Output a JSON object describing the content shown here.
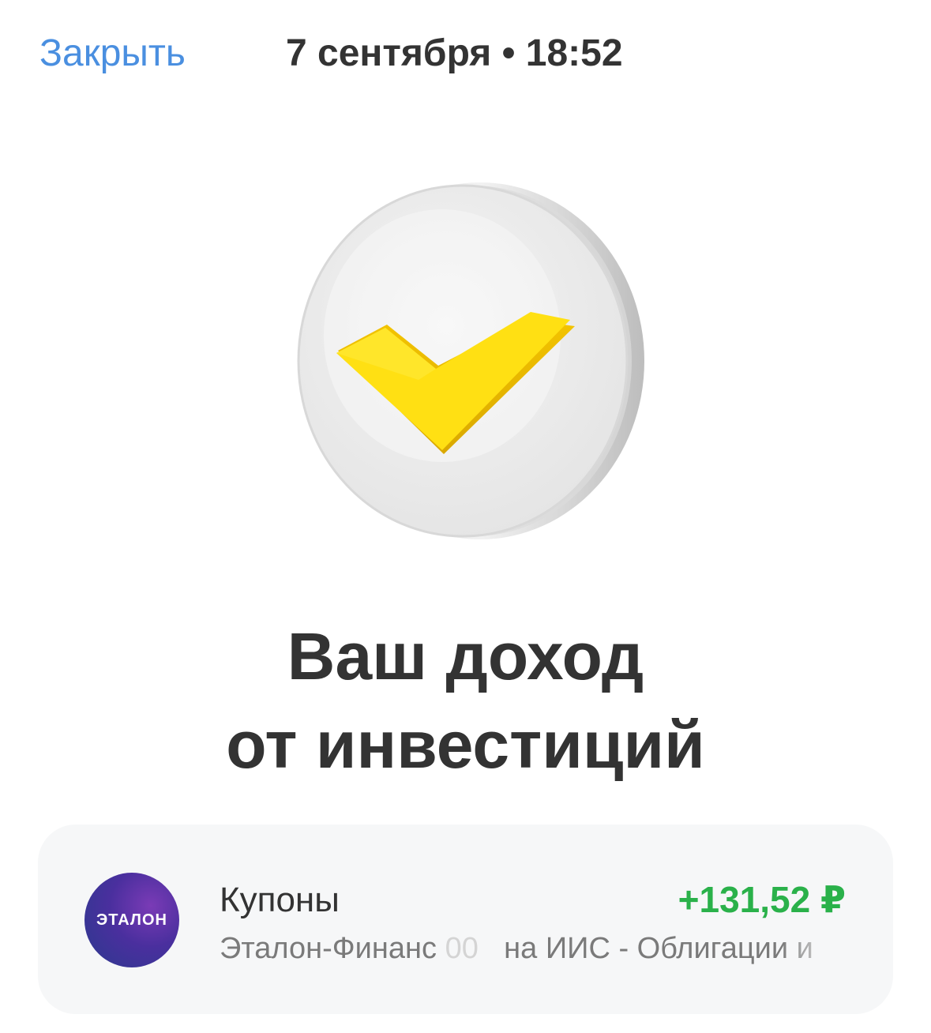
{
  "header": {
    "close_label": "Закрыть",
    "datetime": "7 сентября • 18:52"
  },
  "illustration": {
    "icon": "yellow-check-coin-icon",
    "check_color": "#ffe013"
  },
  "title": {
    "line1": "Ваш доход",
    "line2": "от инвестиций"
  },
  "operation": {
    "logo_text": "ЭТАЛОН",
    "label": "Купоны",
    "amount": "+131,52 ₽",
    "amount_color": "#2ab14a",
    "description_start": "Эталон-Финанс",
    "description_hidden": "00",
    "description_end": "на ИИС - Облигации и"
  }
}
